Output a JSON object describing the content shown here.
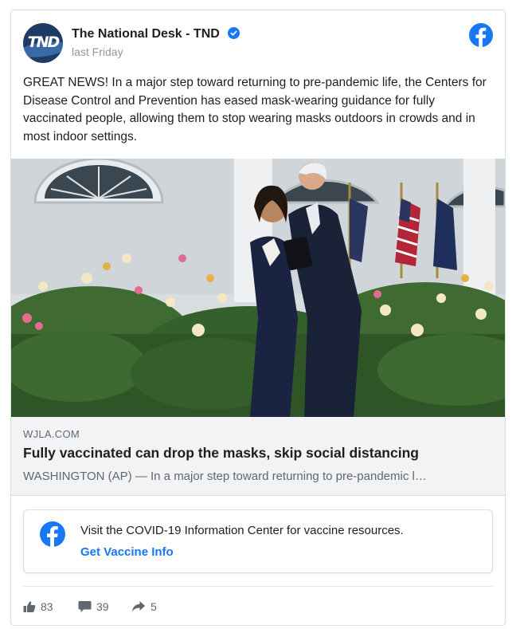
{
  "post": {
    "page_name": "The National Desk - TND",
    "avatar_text": "TND",
    "timestamp": "last Friday",
    "text": "GREAT NEWS! In a major step toward returning to pre-pandemic life, the Centers for Disease Control and Prevention has eased mask-wearing guidance for fully vaccinated people, allowing them to stop wearing masks outdoors in crowds and in most indoor settings."
  },
  "link": {
    "domain": "WJLA.COM",
    "title": "Fully vaccinated can drop the masks, skip social distancing",
    "description": "WASHINGTON (AP) — In a major step toward returning to pre-pandemic l…"
  },
  "info_box": {
    "text": "Visit the COVID-19 Information Center for vaccine resources.",
    "link_label": "Get Vaccine Info"
  },
  "stats": {
    "likes": "83",
    "comments": "39",
    "shares": "5"
  },
  "colors": {
    "facebook_blue": "#1877f2",
    "muted_text": "#606770"
  },
  "icons": [
    "verified-badge-icon",
    "facebook-logo-icon",
    "like-icon",
    "comment-icon",
    "share-icon"
  ]
}
